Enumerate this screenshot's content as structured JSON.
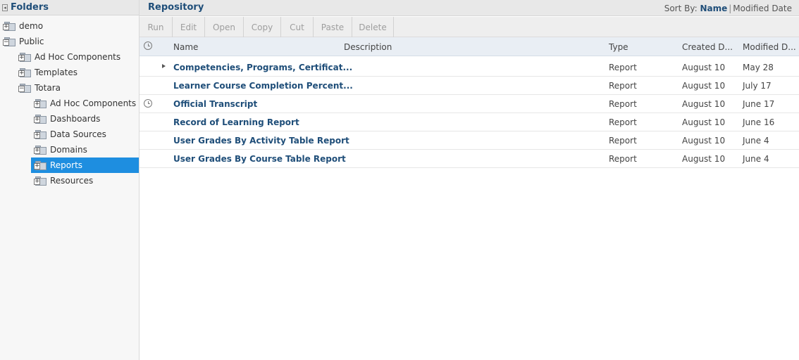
{
  "folders_panel": {
    "title": "Folders",
    "items": [
      {
        "label": "demo"
      },
      {
        "label": "Public"
      },
      {
        "label": "Ad Hoc Components"
      },
      {
        "label": "Templates"
      },
      {
        "label": "Totara"
      },
      {
        "label": "Ad Hoc Components"
      },
      {
        "label": "Dashboards"
      },
      {
        "label": "Data Sources"
      },
      {
        "label": "Domains"
      },
      {
        "label": "Reports"
      },
      {
        "label": "Resources"
      }
    ]
  },
  "repository": {
    "title": "Repository",
    "sort": {
      "label": "Sort By:",
      "active": "Name",
      "option": "Modified Date"
    },
    "toolbar": [
      "Run",
      "Edit",
      "Open",
      "Copy",
      "Cut",
      "Paste",
      "Delete"
    ],
    "columns": {
      "name": "Name",
      "description": "Description",
      "type": "Type",
      "created": "Created D...",
      "modified": "Modified D..."
    },
    "rows": [
      {
        "name": "Competencies, Programs, Certificat...",
        "type": "Report",
        "created": "August 10",
        "modified": "May 28"
      },
      {
        "name": "Learner Course Completion Percent...",
        "type": "Report",
        "created": "August 10",
        "modified": "July 17"
      },
      {
        "name": "Official Transcript",
        "type": "Report",
        "created": "August 10",
        "modified": "June 17"
      },
      {
        "name": "Record of Learning Report",
        "type": "Report",
        "created": "August 10",
        "modified": "June 16"
      },
      {
        "name": "User Grades By Activity Table Report",
        "type": "Report",
        "created": "August 10",
        "modified": "June 4"
      },
      {
        "name": "User Grades By Course Table Report",
        "type": "Report",
        "created": "August 10",
        "modified": "June 4"
      }
    ]
  }
}
